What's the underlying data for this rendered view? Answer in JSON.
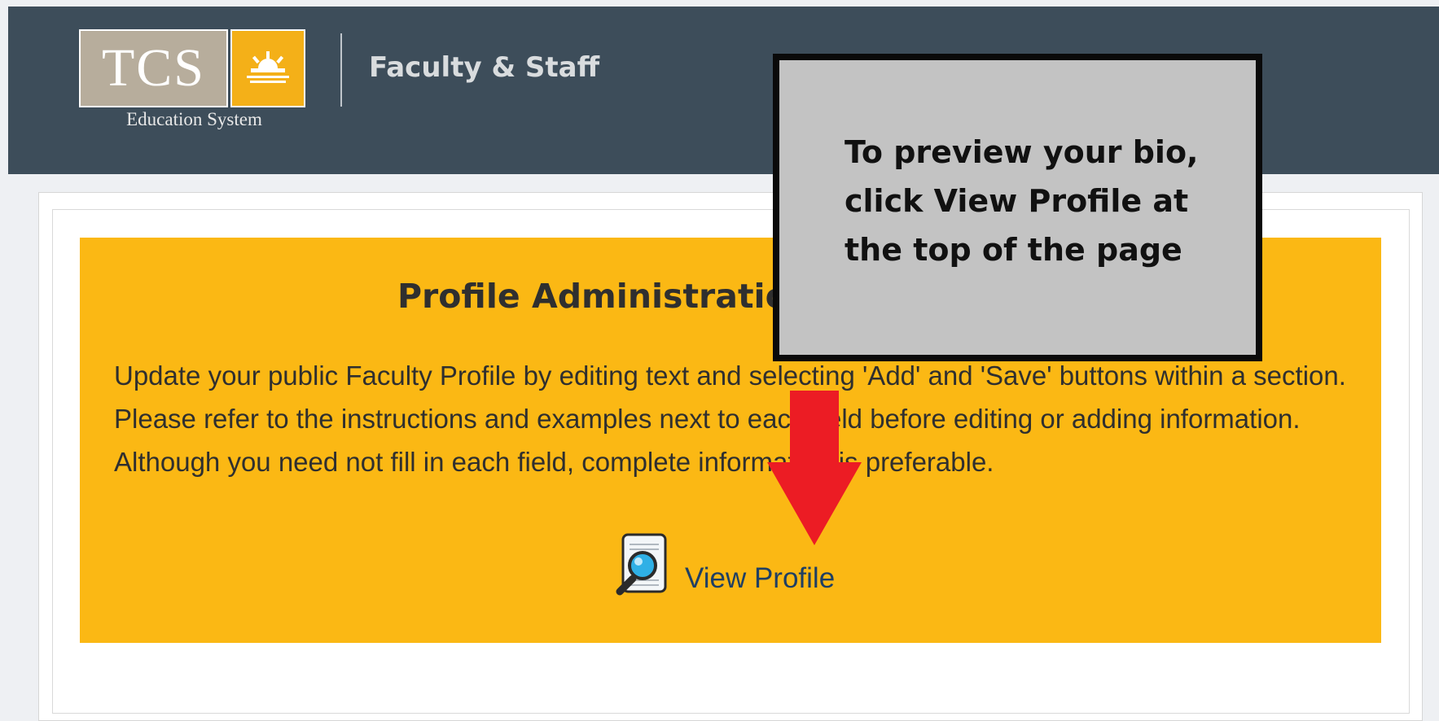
{
  "header": {
    "logo_text": "TCS",
    "logo_caption": "Education System",
    "title": "Faculty & Staff"
  },
  "panel": {
    "title": "Profile Administration",
    "description": "Update your public Faculty Profile by editing text and selecting 'Add' and 'Save' buttons within a section. Please refer to the instructions and examples next to each field before editing or adding information. Although you need not fill in each field, complete information is preferable.",
    "view_profile_label": "View Profile"
  },
  "callout": {
    "text": "To preview your bio, click View Profile at the top of the page"
  },
  "icons": {
    "logo": "sun-logo-icon",
    "view_profile": "magnifier-document-icon",
    "arrow": "red-down-arrow"
  },
  "colors": {
    "header_bg": "#3d4d5a",
    "panel_bg": "#fbb814",
    "callout_bg": "#c3c3c3",
    "arrow": "#ec1c24",
    "link": "#1f3f63"
  }
}
